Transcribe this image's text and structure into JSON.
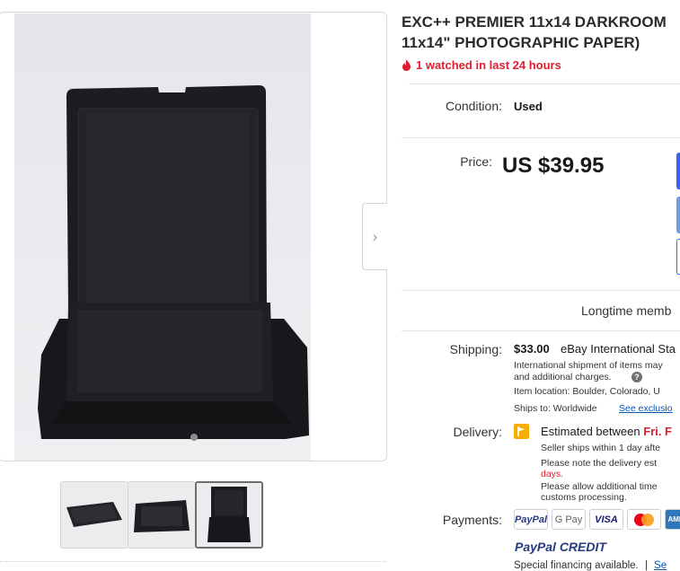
{
  "listing": {
    "title_line1": "EXC++ PREMIER 11x14 DARKROOM",
    "title_line2": "11x14\" PHOTOGRAPHIC PAPER)",
    "watched": "1 watched in last 24 hours"
  },
  "condition": {
    "label": "Condition:",
    "value": "Used"
  },
  "price": {
    "label": "Price:",
    "value": "US $39.95"
  },
  "seller": {
    "member_text": "Longtime memb"
  },
  "shipping": {
    "label": "Shipping:",
    "cost": "$33.00",
    "service": "eBay International Sta",
    "note_line1": "International shipment of items may",
    "note_line2": "and additional charges.",
    "location": "Item location:  Boulder, Colorado, U",
    "ships_to": "Ships to:  Worldwide",
    "exclusions_link": "See exclusio"
  },
  "delivery": {
    "label": "Delivery:",
    "estimated_prefix": "Estimated between",
    "estimated_date": "Fri. F",
    "ships_within": "Seller ships within 1 day afte",
    "note_line1": "Please note the delivery est",
    "note_line2": "days.",
    "customs_line1": "Please allow additional time",
    "customs_line2": "customs processing."
  },
  "payments": {
    "label": "Payments:",
    "methods": [
      "PayPal",
      "G Pay",
      "VISA",
      "Mastercard",
      "AMEX"
    ],
    "paypal_credit": "PayPal CREDIT",
    "financing_text": "Special financing available.",
    "financing_sep": "|",
    "financing_link": "Se"
  },
  "gallery": {
    "thumbnails": [
      "thumb-1",
      "thumb-2",
      "thumb-3"
    ],
    "selected_index": 2
  },
  "colors": {
    "accent_blue": "#0654ba",
    "alert_red": "#dd1e31",
    "buy_button": "#3665f3",
    "delivery_flag": "#f5af02"
  },
  "icons": [
    "fire-icon",
    "chevron-right-icon",
    "help-icon",
    "flag-icon"
  ]
}
